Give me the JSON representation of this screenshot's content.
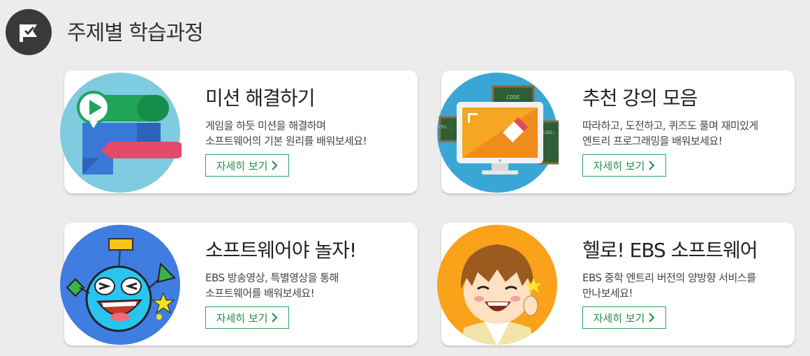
{
  "header": {
    "title": "주제별 학습과정",
    "icon": "flag-check-icon"
  },
  "cards": [
    {
      "title": "미션 해결하기",
      "desc_line1": "게임을 하듯 미션을 해결하며",
      "desc_line2": "소프트웨어의 기본 원리를 배워보세요!",
      "button": "자세히 보기",
      "icon": "speech-bubbles-play-icon"
    },
    {
      "title": "추천 강의 모음",
      "desc_line1": "따라하고, 도전하고, 퀴즈도 풀며 재미있게",
      "desc_line2": "엔트리 프로그래밍을 배워보세요!",
      "button": "자세히 보기",
      "icon": "monitor-code-icon",
      "art_text": {
        "code": "CODE",
        "left": "(PU... COD",
        "right": "CODE;"
      }
    },
    {
      "title": "소프트웨어야 놀자!",
      "desc_line1": "EBS 방송영상, 특별영상을 통해",
      "desc_line2": "소프트웨어를 배워보세요!",
      "button": "자세히 보기",
      "icon": "blue-character-icon"
    },
    {
      "title": "헬로! EBS 소프트웨어",
      "desc_line1": "EBS 중학 엔트리 버전의 양방향 서비스를",
      "desc_line2": "만나보세요!",
      "button": "자세히 보기",
      "icon": "cartoon-student-icon"
    }
  ]
}
